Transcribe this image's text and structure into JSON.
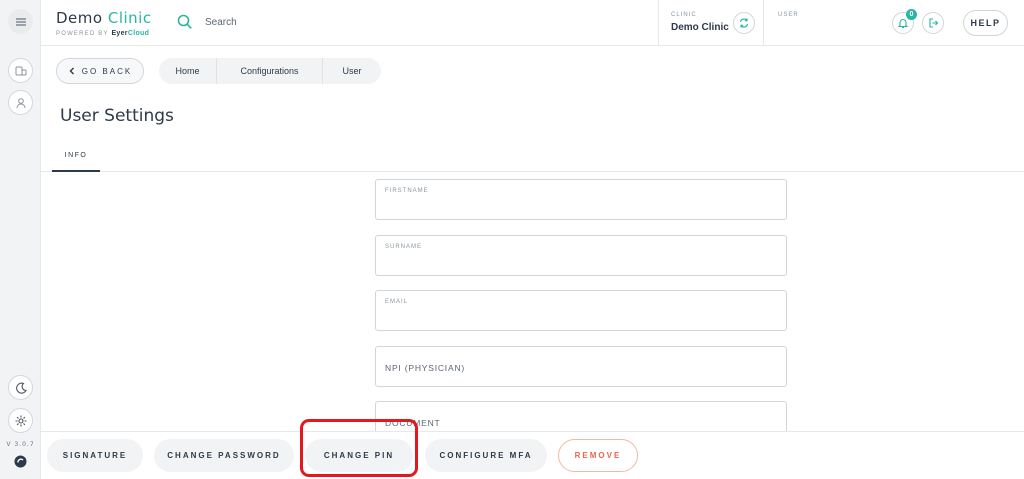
{
  "app": {
    "name_prefix": "Demo ",
    "name_accent": "Clinic",
    "powered_by": "POWERED BY",
    "vendor_prefix": "Eyer",
    "vendor_accent": "Cloud",
    "version": "V 3.0.7"
  },
  "rail": {
    "items": [
      {
        "icon": "menu-icon"
      },
      {
        "icon": "clinic-icon"
      },
      {
        "icon": "user-icon"
      },
      {
        "icon": "moon-icon"
      },
      {
        "icon": "gear-icon"
      }
    ]
  },
  "header": {
    "search_placeholder": "Search",
    "clinic_label": "CLINIC",
    "clinic_name": "Demo Clinic",
    "user_label": "USER",
    "user_name": "",
    "notifications_count": "0",
    "help_label": "HELP"
  },
  "nav": {
    "back_label": "GO BACK",
    "breadcrumbs": [
      "Home",
      "Configurations",
      "User"
    ]
  },
  "page": {
    "title": "User Settings",
    "tabs": [
      "INFO"
    ]
  },
  "form": {
    "fields": [
      {
        "label": "FIRSTNAME",
        "value": ""
      },
      {
        "label": "SURNAME",
        "value": ""
      },
      {
        "label": "EMAIL",
        "value": ""
      },
      {
        "label": "NPI (PHYSICIAN)",
        "value": ""
      },
      {
        "label": "DOCUMENT",
        "value": ""
      }
    ]
  },
  "footer": {
    "buttons": [
      "SIGNATURE",
      "CHANGE PASSWORD",
      "CHANGE PIN",
      "CONFIGURE MFA",
      "REMOVE"
    ]
  },
  "colors": {
    "accent": "#2bb5a3",
    "danger": "#e8694a",
    "highlight": "#e5181d"
  }
}
